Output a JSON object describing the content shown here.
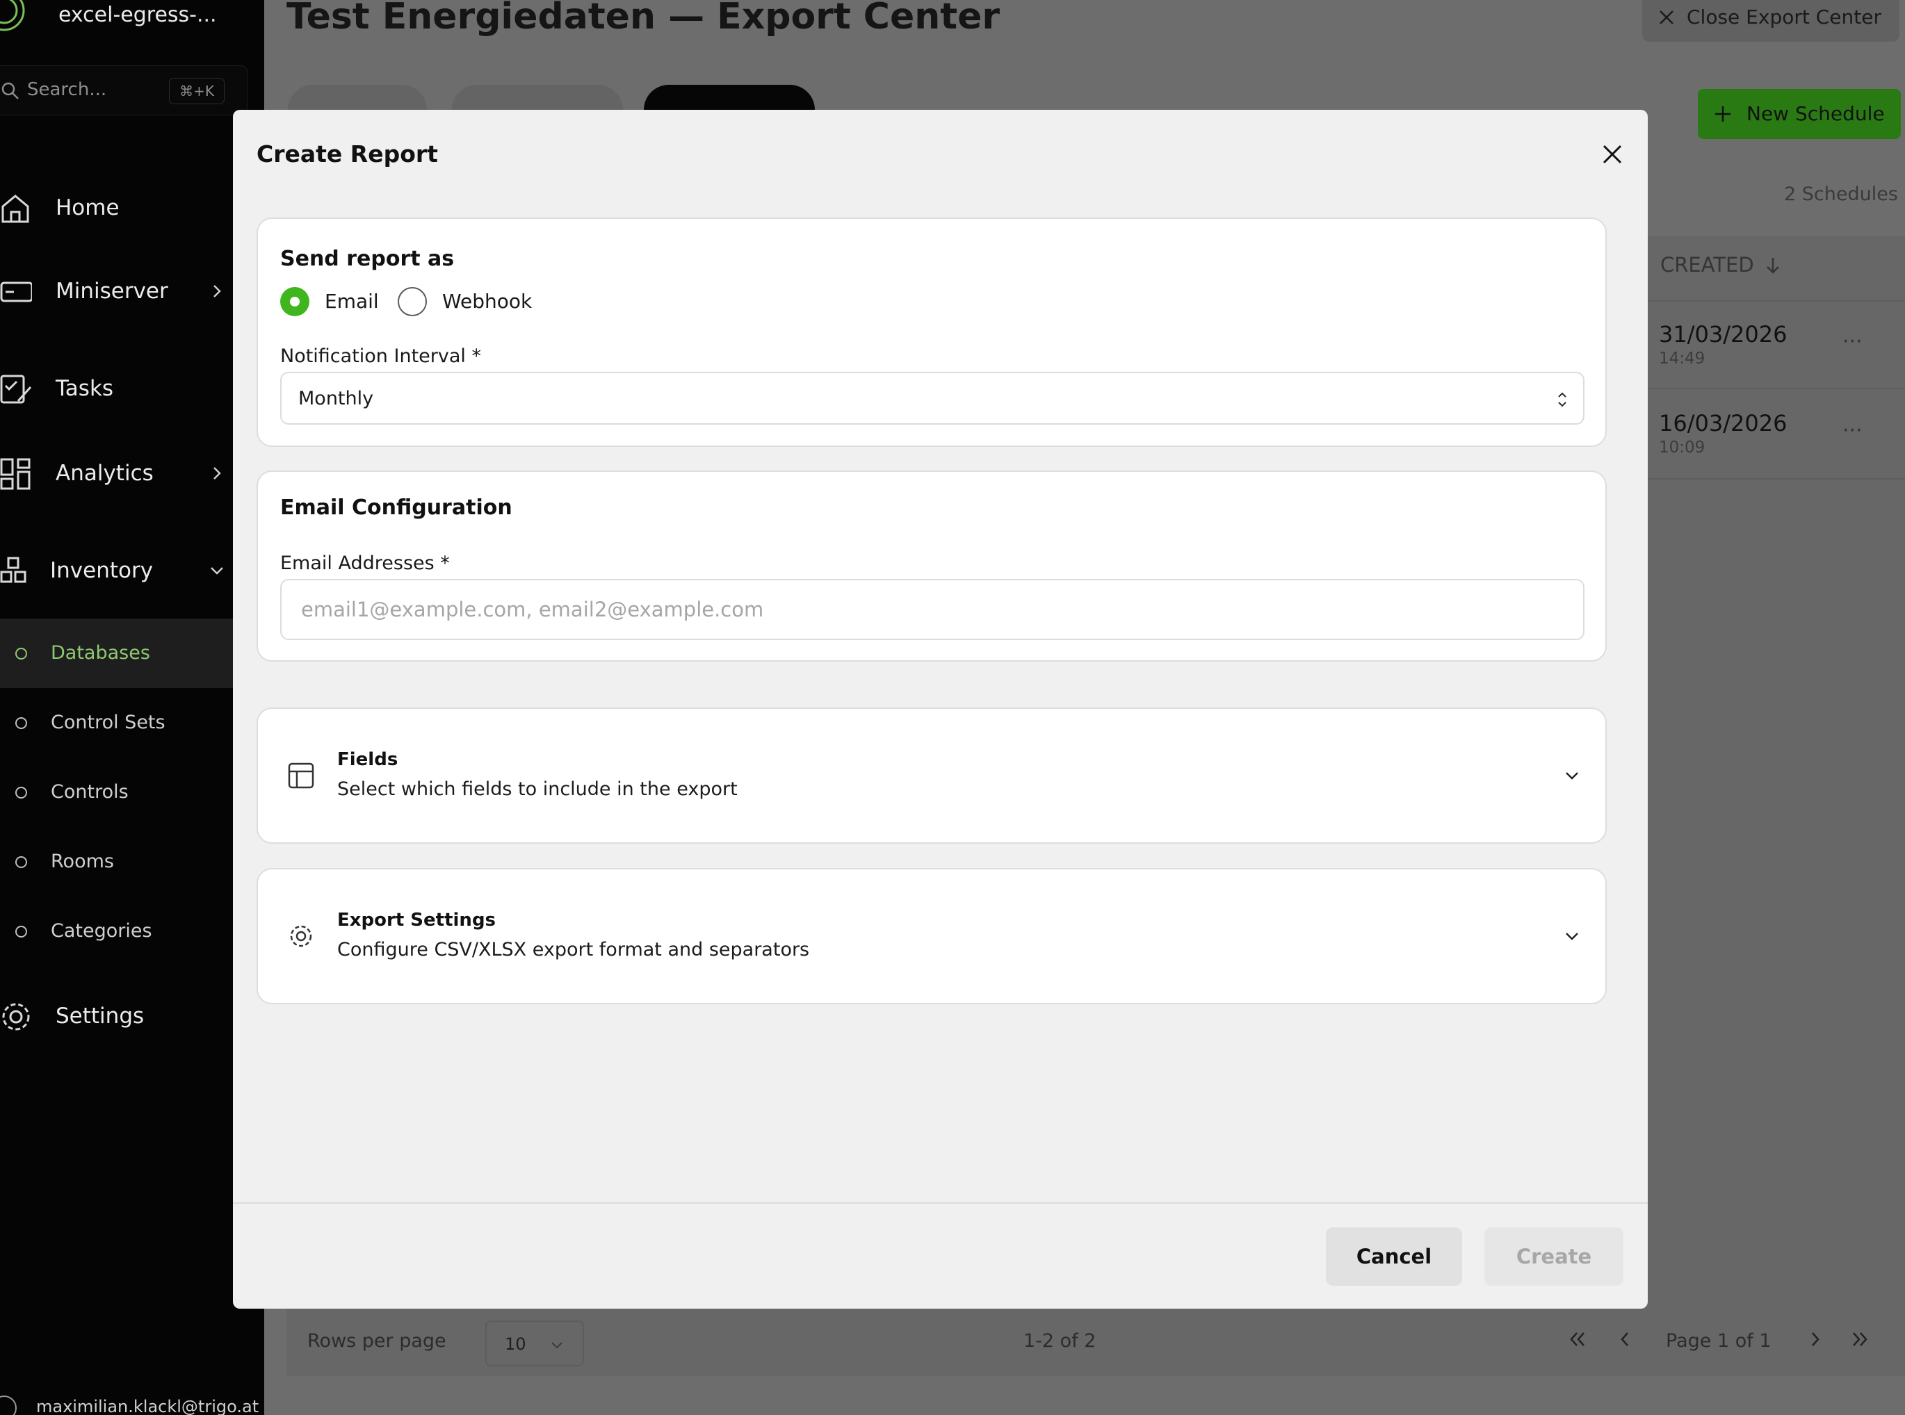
{
  "sidebar": {
    "workspace_name": "excel-egress-...",
    "search_placeholder": "Search...",
    "search_shortcut": "⌘+K",
    "nav": {
      "home": "Home",
      "miniserver": "Miniserver",
      "tasks": "Tasks",
      "analytics": "Analytics",
      "inventory": "Inventory",
      "settings": "Settings"
    },
    "inventory_items": [
      "Databases",
      "Control Sets",
      "Controls",
      "Rooms",
      "Categories"
    ],
    "active_item": "Databases",
    "user_email": "maximilian.klackl@trigo.at"
  },
  "main": {
    "page_title": "Test Energiedaten — Export Center",
    "close_export_label": "Close Export Center",
    "new_schedule_label": "New Schedule",
    "schedule_count": "2 Schedules",
    "created_column": "CREATED",
    "rows": [
      {
        "date": "31/03/2026",
        "time": "14:49",
        "more": "···"
      },
      {
        "date": "16/03/2026",
        "time": "10:09",
        "more": "···"
      }
    ],
    "pagination": {
      "rows_per_page_label": "Rows per page",
      "rows_per_page_value": "10",
      "range": "1-2 of 2",
      "page": "Page 1 of 1"
    }
  },
  "modal": {
    "title": "Create Report",
    "send_as": {
      "title": "Send report as",
      "options": [
        "Email",
        "Webhook"
      ],
      "selected": "Email"
    },
    "interval": {
      "label": "Notification Interval *",
      "value": "Monthly"
    },
    "email_config": {
      "title": "Email Configuration",
      "addresses_label": "Email Addresses *",
      "addresses_placeholder": "email1@example.com, email2@example.com",
      "addresses_value": ""
    },
    "fields_section": {
      "title": "Fields",
      "description": "Select which fields to include in the export"
    },
    "export_settings_section": {
      "title": "Export Settings",
      "description": "Configure CSV/XLSX export format and separators"
    },
    "cancel_label": "Cancel",
    "create_label": "Create"
  },
  "colors": {
    "accent_green": "#3fb61e",
    "sidebar_bg": "#050505",
    "active_sidebar_text": "#8ec971",
    "overlay": "#6d6d6d"
  }
}
